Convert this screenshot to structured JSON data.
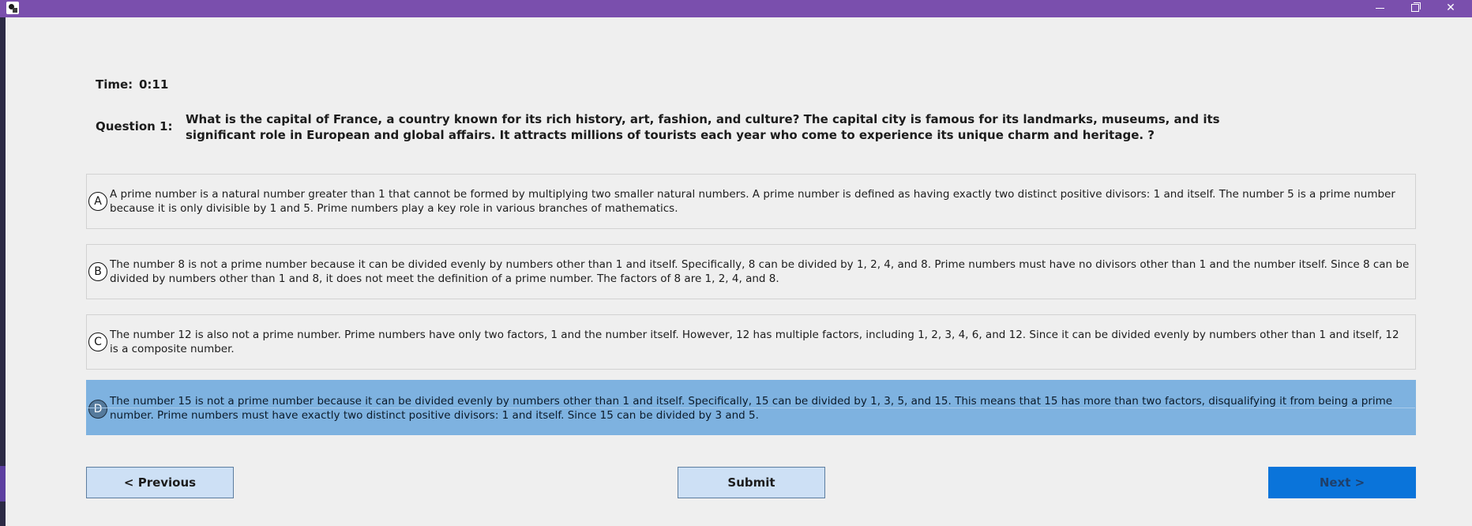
{
  "window": {
    "minimize_icon": "minimize-icon",
    "maximize_icon": "restore-icon",
    "close_icon": "close-icon",
    "close_glyph": "✕"
  },
  "timer": {
    "label": "Time:",
    "value": "0:11"
  },
  "question": {
    "label": "Question 1:",
    "text": "What is the capital of France, a country known for its rich history, art, fashion, and culture? The capital city is famous for its landmarks, museums, and its significant role in European and global affairs. It attracts millions of tourists each year who come to experience its unique charm and heritage. ?"
  },
  "options": [
    {
      "letter": "A",
      "text": "A prime number is a natural number greater than 1 that cannot be formed by multiplying two smaller natural numbers. A prime number is defined as having exactly two distinct positive divisors: 1 and itself. The number 5 is a prime number because it is only divisible by 1 and 5. Prime numbers play a key role in various branches of mathematics."
    },
    {
      "letter": "B",
      "text": "The number 8 is not a prime number because it can be divided evenly by numbers other than 1 and itself. Specifically, 8 can be divided by 1, 2, 4, and 8. Prime numbers must have no divisors other than 1 and the number itself. Since 8 can be divided by numbers other than 1 and 8, it does not meet the definition of a prime number. The factors of 8 are 1, 2, 4, and 8."
    },
    {
      "letter": "C",
      "text": "The number 12 is also not a prime number. Prime numbers have only two factors, 1 and the number itself. However, 12 has multiple factors, including 1, 2, 3, 4, 6, and 12. Since it can be divided evenly by numbers other than 1 and itself, 12 is a composite number."
    },
    {
      "letter": "D",
      "text": "The number 15 is not a prime number because it can be divided evenly by numbers other than 1 and itself. Specifically, 15 can be divided by 1, 3, 5, and 15. This means that 15 has more than two factors, disqualifying it from being a prime number. Prime numbers must have exactly two distinct positive divisors: 1 and itself. Since 15 can be divided by 3 and 5."
    }
  ],
  "selected_option": "D",
  "buttons": {
    "previous": "< Previous",
    "submit": "Submit",
    "next": "Next >"
  },
  "colors": {
    "titlebar": "#7a4fad",
    "selected_option": "#7eb2e0",
    "next_button": "#0a74da",
    "secondary_button": "#cde0f5"
  }
}
